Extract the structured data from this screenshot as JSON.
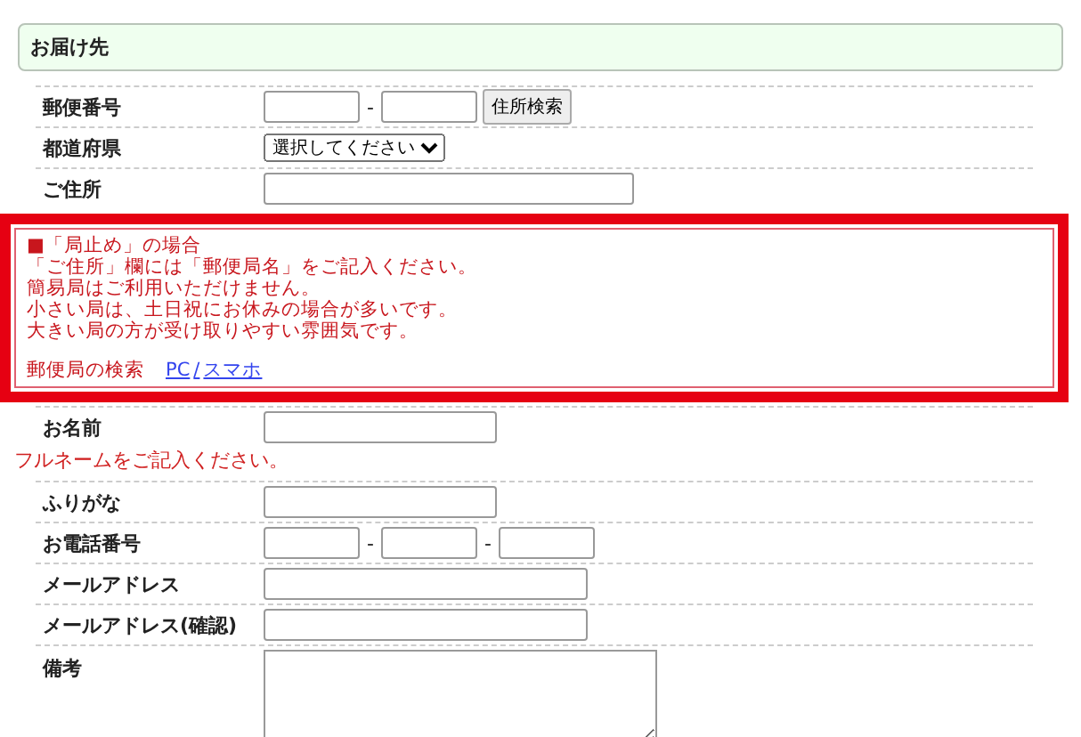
{
  "section_title": "お届け先",
  "rows": [
    {
      "label": "郵便番号",
      "kind": "zip",
      "separator": "-",
      "button": "住所検索"
    },
    {
      "label": "都道府県",
      "kind": "select",
      "value": "選択してください"
    },
    {
      "label": "ご住所",
      "kind": "address"
    },
    {
      "kind": "notice"
    },
    {
      "label": "お名前",
      "kind": "name",
      "hint": "フルネームをご記入ください。"
    },
    {
      "label": "ふりがな",
      "kind": "name"
    },
    {
      "label": "お電話番号",
      "kind": "phone",
      "separator": "-"
    },
    {
      "label": "メールアドレス",
      "kind": "email"
    },
    {
      "label": "メールアドレス(確認)",
      "kind": "email"
    },
    {
      "label": "備考",
      "kind": "memo"
    }
  ],
  "notice": {
    "lines": [
      "■「局止め」の場合",
      "「ご住所」欄には「郵便局名」をご記入ください。",
      "簡易局はご利用いただけません。",
      "小さい局は、土日祝にお休みの場合が多いです。",
      "大きい局の方が受け取りやすい雰囲気です。"
    ],
    "search_label": "郵便局の検索",
    "links": [
      "PC",
      "スマホ"
    ],
    "link_separator": "/"
  }
}
